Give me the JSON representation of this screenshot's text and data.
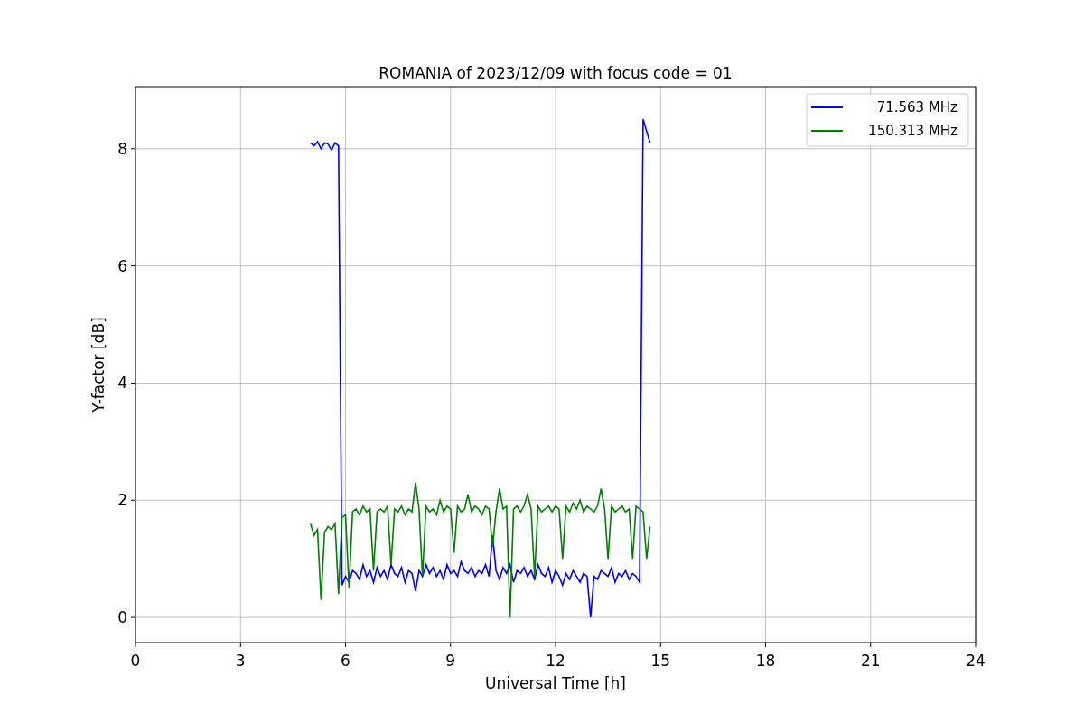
{
  "chart": {
    "chart_data": {
      "type": "line",
      "title": "ROMANIA of 2023/12/09 with focus code = 01",
      "xlabel": "Universal Time [h]",
      "ylabel": "Y-factor [dB]",
      "x": [
        5.0,
        5.1,
        5.2,
        5.3,
        5.4,
        5.5,
        5.6,
        5.7,
        5.8,
        5.9,
        6.0,
        6.1,
        6.2,
        6.3,
        6.4,
        6.5,
        6.6,
        6.7,
        6.8,
        6.9,
        7.0,
        7.1,
        7.2,
        7.3,
        7.4,
        7.5,
        7.6,
        7.7,
        7.8,
        7.9,
        8.0,
        8.1,
        8.2,
        8.3,
        8.4,
        8.5,
        8.6,
        8.7,
        8.8,
        8.9,
        9.0,
        9.1,
        9.2,
        9.3,
        9.4,
        9.5,
        9.6,
        9.7,
        9.8,
        9.9,
        10.0,
        10.1,
        10.2,
        10.3,
        10.4,
        10.5,
        10.6,
        10.7,
        10.8,
        10.9,
        11.0,
        11.1,
        11.2,
        11.3,
        11.4,
        11.5,
        11.6,
        11.7,
        11.8,
        11.9,
        12.0,
        12.1,
        12.2,
        12.3,
        12.4,
        12.5,
        12.6,
        12.7,
        12.8,
        12.9,
        13.0,
        13.1,
        13.2,
        13.3,
        13.4,
        13.5,
        13.6,
        13.7,
        13.8,
        13.9,
        14.0,
        14.1,
        14.2,
        14.3,
        14.4,
        14.5,
        14.6,
        14.7
      ],
      "series": [
        {
          "name": "71.563 MHz",
          "color": "#0000ff",
          "values": [
            8.1,
            8.05,
            8.12,
            8.0,
            8.1,
            8.08,
            7.98,
            8.1,
            8.05,
            0.55,
            0.7,
            0.6,
            0.8,
            0.75,
            0.65,
            0.9,
            0.7,
            0.8,
            0.6,
            0.85,
            0.7,
            0.8,
            0.65,
            0.9,
            0.75,
            0.7,
            0.85,
            0.6,
            0.8,
            0.75,
            0.45,
            0.8,
            0.7,
            0.9,
            0.75,
            0.85,
            0.7,
            0.8,
            0.65,
            0.9,
            0.75,
            0.8,
            0.7,
            0.95,
            0.8,
            0.75,
            0.85,
            0.7,
            0.8,
            0.75,
            0.9,
            0.7,
            1.4,
            0.8,
            0.65,
            0.85,
            0.75,
            0.9,
            0.6,
            0.8,
            0.75,
            0.85,
            0.7,
            0.8,
            0.65,
            0.9,
            0.75,
            0.7,
            0.85,
            0.6,
            0.8,
            0.7,
            0.55,
            0.75,
            0.65,
            0.8,
            0.7,
            0.6,
            0.75,
            0.7,
            0.0,
            0.7,
            0.65,
            0.8,
            0.75,
            0.7,
            0.85,
            0.6,
            0.75,
            0.7,
            0.8,
            0.65,
            0.75,
            0.7,
            0.6,
            8.5,
            8.3,
            8.1
          ]
        },
        {
          "name": "150.313 MHz",
          "color": "#008000",
          "values": [
            1.6,
            1.4,
            1.5,
            0.3,
            1.45,
            1.55,
            1.5,
            1.6,
            0.4,
            1.7,
            1.75,
            0.5,
            1.8,
            1.85,
            1.75,
            1.9,
            1.8,
            1.85,
            0.8,
            1.8,
            1.85,
            1.8,
            1.9,
            0.9,
            1.85,
            1.8,
            1.9,
            1.75,
            1.85,
            1.8,
            2.3,
            1.85,
            0.7,
            1.9,
            1.8,
            1.85,
            1.75,
            2.0,
            1.8,
            1.9,
            1.85,
            1.1,
            1.9,
            1.8,
            1.85,
            2.1,
            1.8,
            1.9,
            1.85,
            1.75,
            1.9,
            1.85,
            1.2,
            1.8,
            2.2,
            1.85,
            1.9,
            0.0,
            1.85,
            1.9,
            1.8,
            1.9,
            2.1,
            1.85,
            0.7,
            1.9,
            1.8,
            1.85,
            1.9,
            1.8,
            1.9,
            1.85,
            1.0,
            1.9,
            1.8,
            1.95,
            1.85,
            2.0,
            1.8,
            1.9,
            1.85,
            1.8,
            1.9,
            2.2,
            1.85,
            1.0,
            1.9,
            1.8,
            1.85,
            1.9,
            1.8,
            1.85,
            1.0,
            1.9,
            1.85,
            1.8,
            1.0,
            1.55
          ]
        }
      ],
      "xlim": [
        0,
        24
      ],
      "ylim": [
        -0.43,
        9.06
      ],
      "xticks": [
        0,
        3,
        6,
        9,
        12,
        15,
        18,
        21,
        24
      ],
      "yticks": [
        0,
        2,
        4,
        6,
        8
      ],
      "grid": true
    }
  }
}
